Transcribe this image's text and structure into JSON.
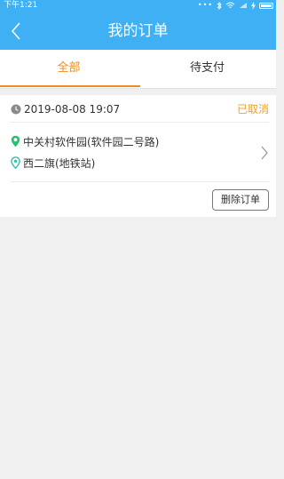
{
  "status_bar": {
    "time": "下午1:21"
  },
  "header": {
    "title": "我的订单",
    "back_icon": "chevron-left-icon"
  },
  "tabs": [
    {
      "label": "全部",
      "active": true
    },
    {
      "label": "待支付",
      "active": false
    }
  ],
  "order": {
    "time": "2019-08-08 19:07",
    "status": "已取消",
    "origin": "中关村软件园(软件园二号路)",
    "destination": "西二旗(地铁站)",
    "delete_label": "删除订单"
  },
  "colors": {
    "header_bg": "#3fb0f3",
    "accent": "#f08a1f",
    "status": "#f0a020",
    "location_pin": "#21c373"
  }
}
